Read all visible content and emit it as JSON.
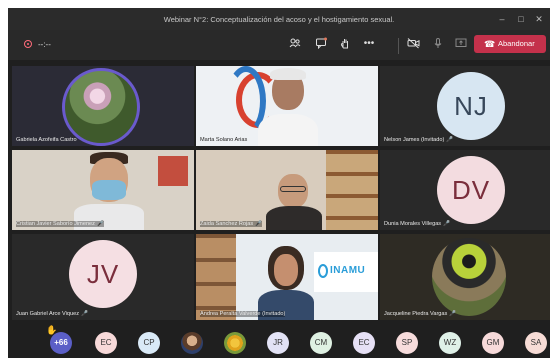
{
  "window": {
    "title": "Webinar N°2: Conceptualización del acoso y el hostigamiento sexual.",
    "minimize_icon": "minimize-icon",
    "maximize_icon": "maximize-icon",
    "close_icon": "close-icon"
  },
  "toolbar": {
    "timer": "--:--",
    "leave_label": "Abandonar",
    "icons": [
      "participants-icon",
      "chat-icon",
      "raise-hand-icon",
      "more-options-icon",
      "camera-off-icon",
      "mic-off-icon",
      "share-screen-icon",
      "phone-icon"
    ],
    "leave_color": "#c4314b"
  },
  "participants": [
    {
      "name": "Gabriela Azofeifa Castro",
      "video": true
    },
    {
      "name": "Marta Solano Arias",
      "video": true
    },
    {
      "name": "Nelson James (Invitado)",
      "initials": "NJ",
      "avatar_color": "#d7e6f2",
      "text_color": "#37475a"
    },
    {
      "name": "Cristian Javier Saborío Jimenez",
      "video": true
    },
    {
      "name": "Zaida Sanchez Rojas",
      "video": true
    },
    {
      "name": "Dunia Morales Villegas",
      "initials": "DV",
      "avatar_color": "#f3dce0",
      "text_color": "#7a2e3c"
    },
    {
      "name": "Juan Gabriel Arce Viquez",
      "initials": "JV",
      "avatar_color": "#f5dfe3",
      "text_color": "#7a2e3c"
    },
    {
      "name": "Andrea Peralta Valverde (Invitado)",
      "video": true,
      "banner": "INAMU"
    },
    {
      "name": "Jacqueline Piedra Vargas",
      "video": true
    }
  ],
  "bottom_bar": {
    "raise_hand_icon": "raised-hand-icon",
    "overflow_count": "+66",
    "chips": [
      {
        "initials": "EC",
        "color": "#f7d9d9"
      },
      {
        "initials": "CP",
        "color": "#d9eaf7"
      },
      {
        "initials": "",
        "photo": true
      },
      {
        "initials": "",
        "photo": true
      },
      {
        "initials": "JR",
        "color": "#e2e2f5"
      },
      {
        "initials": "CM",
        "color": "#dff1e3"
      },
      {
        "initials": "EC",
        "color": "#e6e0f5"
      },
      {
        "initials": "SP",
        "color": "#f7dcdc"
      },
      {
        "initials": "WZ",
        "color": "#dff1e8"
      },
      {
        "initials": "GM",
        "color": "#f7dada"
      },
      {
        "initials": "SA",
        "color": "#f7dcd6"
      }
    ]
  }
}
